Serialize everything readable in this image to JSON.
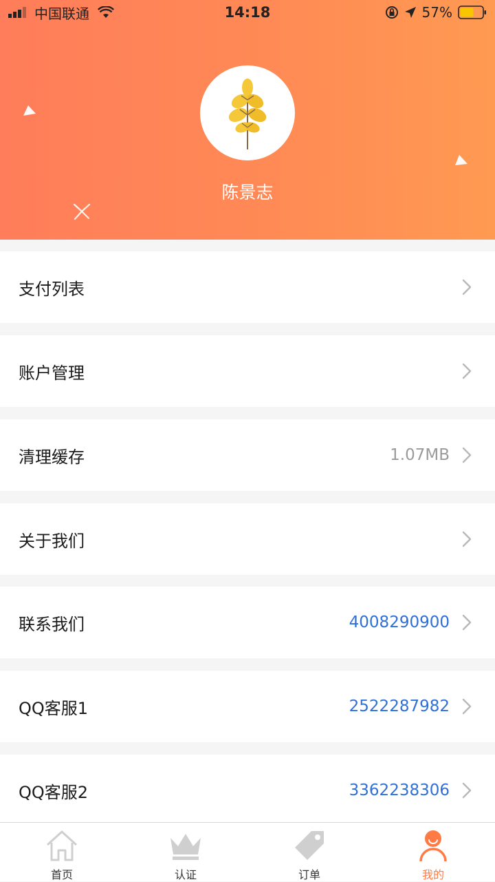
{
  "status_bar": {
    "carrier": "中国联通",
    "time": "14:18",
    "battery": "57%",
    "icons": [
      "signal-icon",
      "wifi-icon",
      "rotation-lock-icon",
      "location-arrow-icon",
      "battery-icon"
    ]
  },
  "profile": {
    "name": "陈景志",
    "avatar_icon": "leaf-icon"
  },
  "menu": {
    "items": [
      {
        "label": "支付列表",
        "value": ""
      },
      {
        "label": "账户管理",
        "value": ""
      },
      {
        "label": "清理缓存",
        "value": "1.07MB"
      },
      {
        "label": "关于我们",
        "value": ""
      },
      {
        "label": "联系我们",
        "value": "4008290900"
      },
      {
        "label": "QQ客服1",
        "value": "2522287982"
      },
      {
        "label": "QQ客服2",
        "value": "3362238306"
      }
    ]
  },
  "tabbar": {
    "tabs": [
      {
        "label": "首页",
        "icon": "home-icon",
        "active": false
      },
      {
        "label": "认证",
        "icon": "crown-icon",
        "active": false
      },
      {
        "label": "订单",
        "icon": "tag-icon",
        "active": false
      },
      {
        "label": "我的",
        "icon": "user-icon",
        "active": true
      }
    ]
  },
  "colors": {
    "header_gradient_start": "#ff7d5a",
    "header_gradient_end": "#ff9a52",
    "accent": "#ff7a45",
    "link_blue": "#2f6fd8",
    "muted_gray": "#9a9a9a",
    "leaf_yellow": "#f5c83a"
  }
}
